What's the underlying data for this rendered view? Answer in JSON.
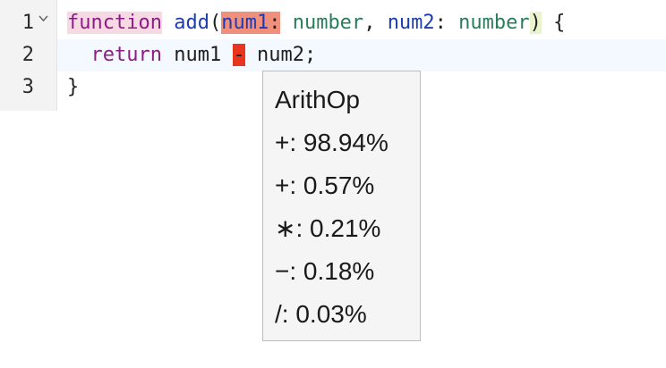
{
  "editor": {
    "line_numbers": [
      "1",
      "2",
      "3"
    ],
    "fold_icon": "chevron-down-icon",
    "lines": {
      "l1": {
        "kw_function": "function",
        "fn_name": "add",
        "open_paren": "(",
        "param1": "num1",
        "colon1": ":",
        "type1_sep": " ",
        "type1": "number",
        "comma": ", ",
        "param2": "num2",
        "colon2": ": ",
        "type2": "number",
        "close_paren": ")",
        "brace_open": " {"
      },
      "l2": {
        "indent": "  ",
        "kw_return": "return",
        "operand1": " num1 ",
        "operator": "-",
        "operand2": " num2;"
      },
      "l3": {
        "brace_close": "}"
      }
    }
  },
  "tooltip": {
    "title": "ArithOp",
    "items": [
      "+: 98.94%",
      "+: 0.57%",
      "∗: 0.21%",
      "−: 0.18%",
      "/: 0.03%"
    ]
  },
  "colors": {
    "keyword": "#8c1c86",
    "function_name": "#1f3bb3",
    "type": "#2a7d5b",
    "param_highlight": "#f08f7b",
    "operator_highlight": "#e8351f",
    "current_line": "#f4f8ff"
  }
}
